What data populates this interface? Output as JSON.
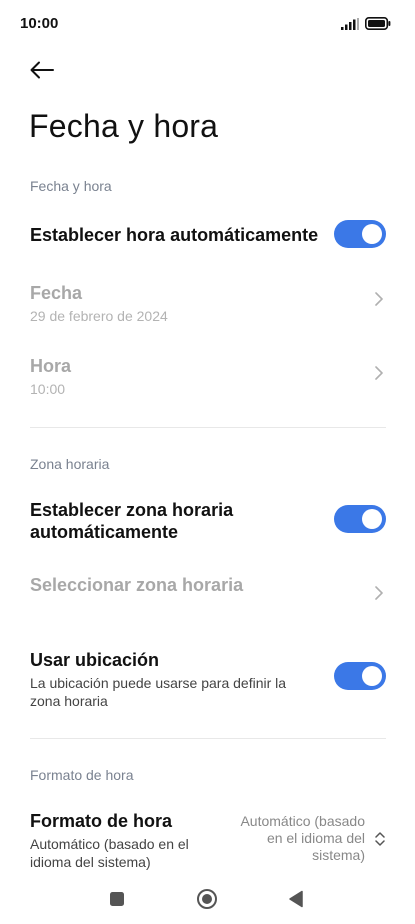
{
  "status_bar": {
    "time": "10:00",
    "icons": [
      "signal-icon",
      "battery-icon"
    ]
  },
  "header": {
    "back_icon": "arrow-left-icon",
    "title": "Fecha y hora"
  },
  "sections": {
    "date_time": {
      "header": "Fecha y hora",
      "auto_time": {
        "label": "Establecer hora automáticamente",
        "enabled": true
      },
      "date": {
        "label": "Fecha",
        "value": "29 de febrero de 2024"
      },
      "time": {
        "label": "Hora",
        "value": "10:00"
      }
    },
    "timezone": {
      "header": "Zona horaria",
      "auto_zone": {
        "label_line1": "Establecer zona horaria",
        "label_line2": "automáticamente",
        "enabled": true
      },
      "select_zone": {
        "label": "Seleccionar zona horaria"
      },
      "use_location": {
        "label": "Usar ubicación",
        "desc_line1": "La ubicación puede usarse para definir la",
        "desc_line2": "zona horaria",
        "enabled": true
      }
    },
    "time_format": {
      "header": "Formato de hora",
      "format": {
        "label": "Formato de hora",
        "desc_line1": "Automático (basado en el",
        "desc_line2": "idioma del sistema)",
        "value_line1": "Automático (basado",
        "value_line2": "en el idioma del",
        "value_line3": "sistema)"
      }
    }
  },
  "nav_bar": {
    "icons": [
      "recents-square-icon",
      "home-circle-icon",
      "back-triangle-icon"
    ]
  },
  "colors": {
    "accent": "#3b78e7",
    "section_header": "#7a8290",
    "disabled_text": "#a8a8a8"
  }
}
